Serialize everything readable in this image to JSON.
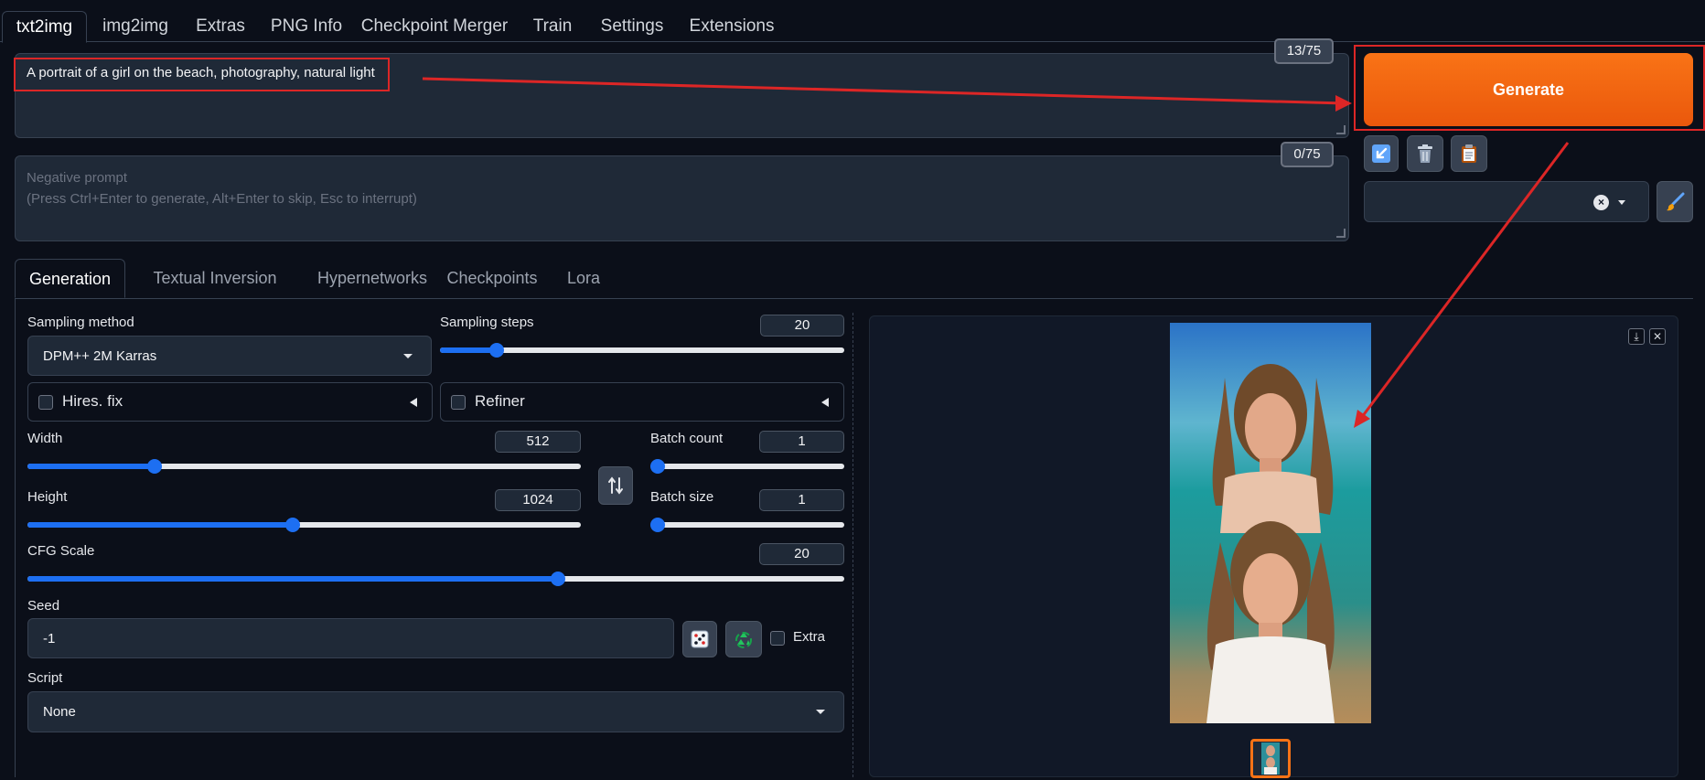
{
  "top_tabs": [
    "txt2img",
    "img2img",
    "Extras",
    "PNG Info",
    "Checkpoint Merger",
    "Train",
    "Settings",
    "Extensions"
  ],
  "prompt": {
    "value": "A portrait of a girl on the beach, photography, natural light",
    "counter": "13/75"
  },
  "negative_prompt": {
    "placeholder": "Negative prompt\n(Press Ctrl+Enter to generate, Alt+Enter to skip, Esc to interrupt)",
    "counter": "0/75"
  },
  "generate_label": "Generate",
  "tool_buttons": [
    "arrow-icon",
    "trash-icon",
    "clipboard-icon"
  ],
  "sub_tabs": [
    "Generation",
    "Textual Inversion",
    "Hypernetworks",
    "Checkpoints",
    "Lora"
  ],
  "generation": {
    "sampling_method": {
      "label": "Sampling method",
      "value": "DPM++ 2M Karras"
    },
    "sampling_steps": {
      "label": "Sampling steps",
      "value": "20",
      "fraction": 0.14
    },
    "hires_fix_label": "Hires. fix",
    "refiner_label": "Refiner",
    "width": {
      "label": "Width",
      "value": "512",
      "fraction": 0.23
    },
    "height": {
      "label": "Height",
      "value": "1024",
      "fraction": 0.48
    },
    "batch_count": {
      "label": "Batch count",
      "value": "1",
      "fraction": 0.0
    },
    "batch_size": {
      "label": "Batch size",
      "value": "1",
      "fraction": 0.0
    },
    "cfg_scale": {
      "label": "CFG Scale",
      "value": "20",
      "fraction": 0.65
    },
    "seed": {
      "label": "Seed",
      "value": "-1",
      "extra_label": "Extra"
    },
    "script": {
      "label": "Script",
      "value": "None"
    }
  },
  "colors": {
    "accent": "#1d6ff2",
    "generate": "#f97316",
    "annotation": "#dc2626"
  }
}
